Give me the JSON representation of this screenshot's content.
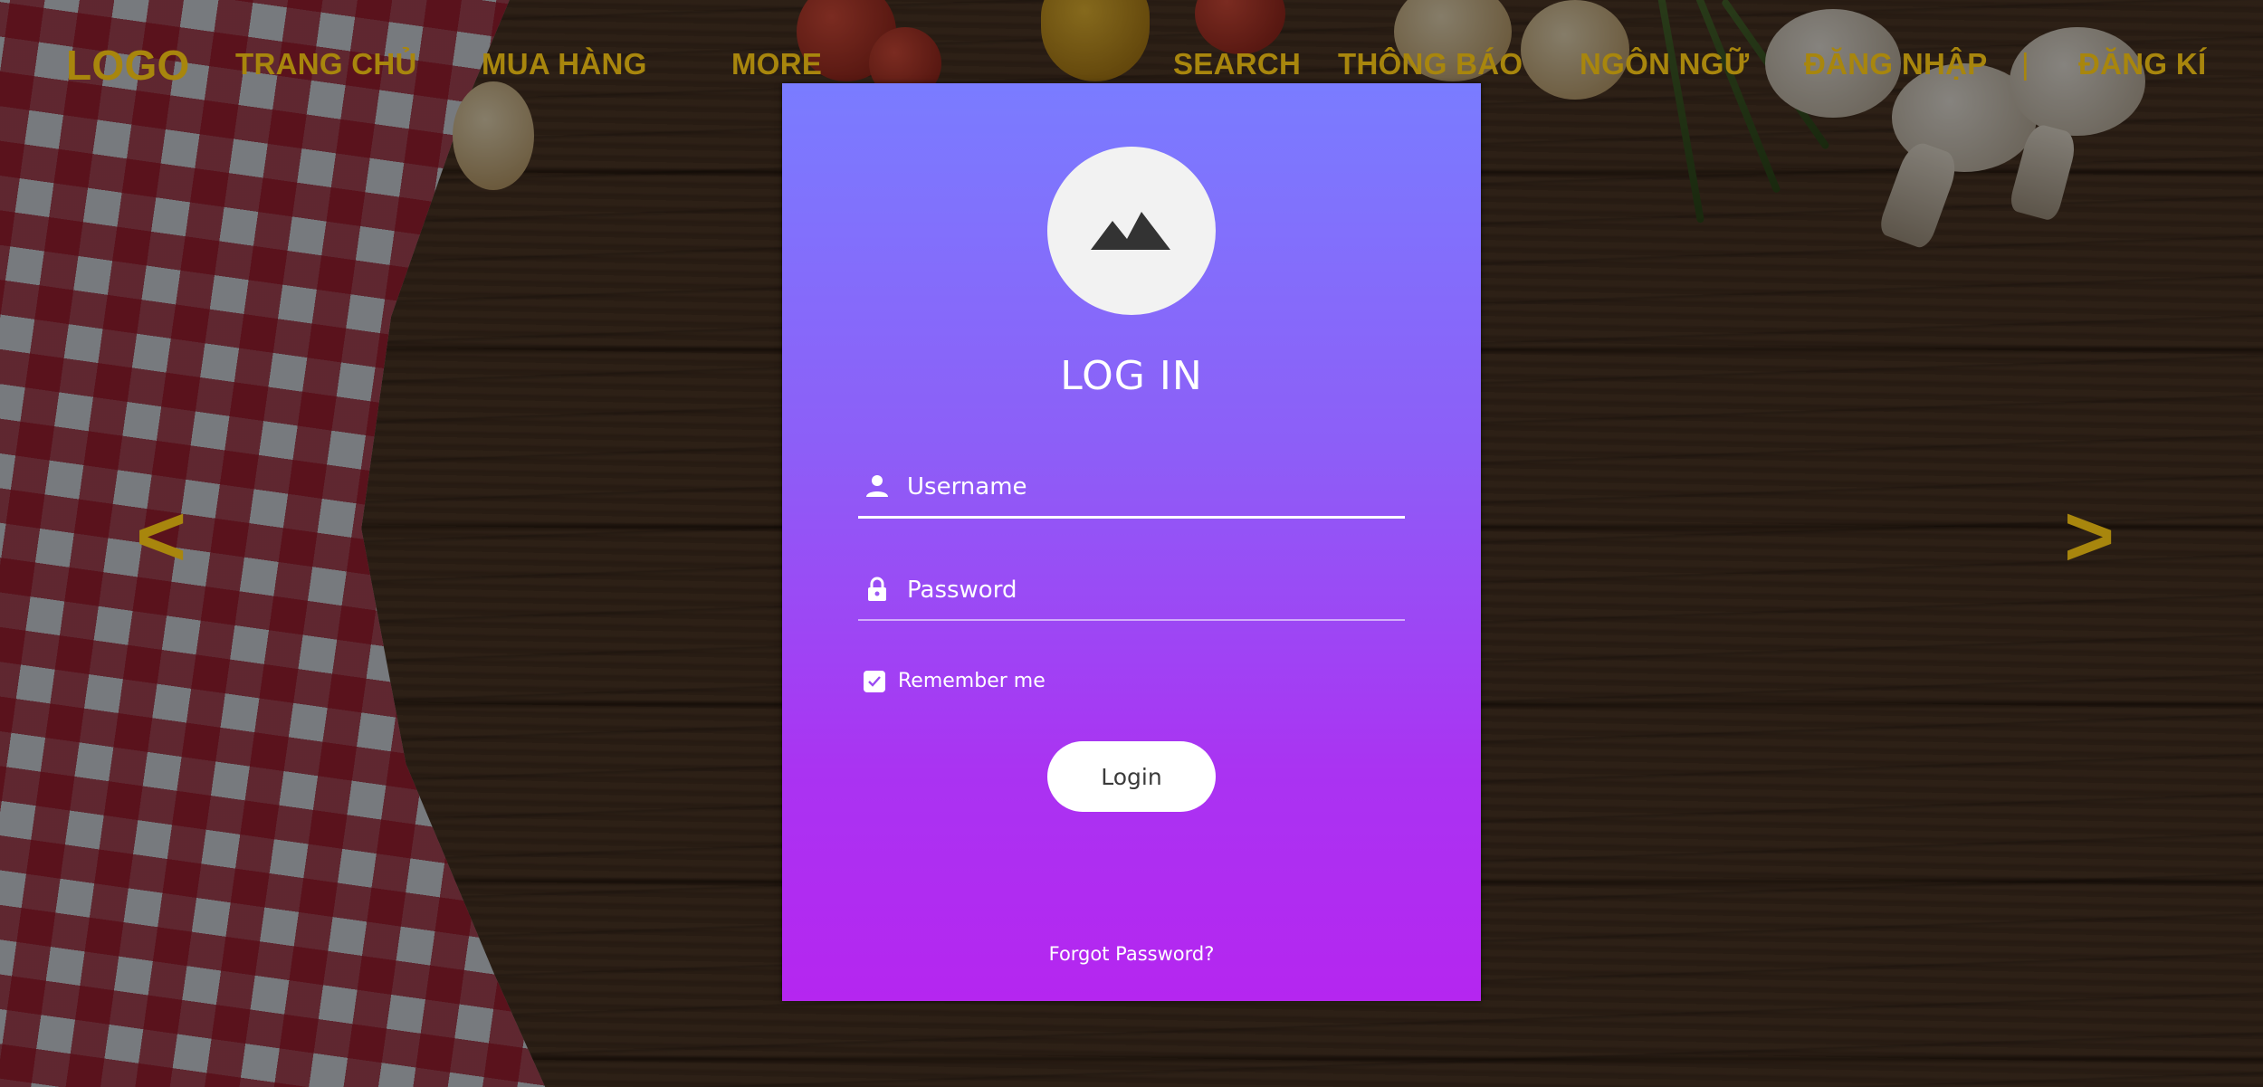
{
  "nav": {
    "logo": "LOGO",
    "items_left": [
      "TRANG CHỦ",
      "MUA HÀNG",
      "MORE"
    ],
    "search": "SEARCH",
    "notifications": "THÔNG BÁO",
    "language": "NGÔN NGỮ",
    "login": "ĐĂNG NHẬP",
    "separator": "|",
    "register": "ĐĂNG KÍ",
    "color": "#a8860d"
  },
  "slider": {
    "prev": "<",
    "next": ">"
  },
  "login_card": {
    "title": "LOG IN",
    "username_placeholder": "Username",
    "password_placeholder": "Password",
    "remember_label": "Remember me",
    "remember_checked": true,
    "login_button": "Login",
    "forgot_password": "Forgot Password?",
    "gradient_top": "#7a7cff",
    "gradient_bottom": "#b526f0"
  }
}
